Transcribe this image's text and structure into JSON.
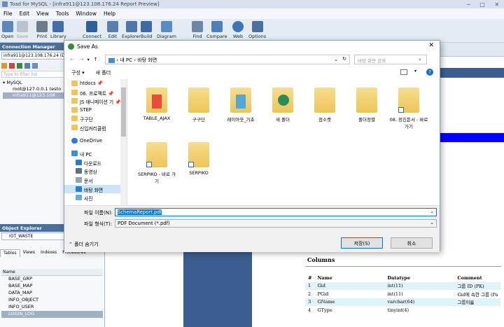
{
  "app": {
    "title": "Toad for MySQL - [infra911@123.108.176.24 Report Preview]"
  },
  "menu": [
    "File",
    "Edit",
    "View",
    "Tools",
    "Window",
    "Help"
  ],
  "toolbar": [
    {
      "label": "Open",
      "icon": "open-icon"
    },
    {
      "label": "Save",
      "icon": "save-icon"
    },
    {
      "label": "Print",
      "icon": "print-icon"
    },
    {
      "label": "Library",
      "icon": "library-icon"
    },
    {
      "label": "Connect",
      "icon": "connect-icon"
    },
    {
      "label": "Edit",
      "icon": "edit-icon"
    },
    {
      "label": "Explorer",
      "icon": "explorer-icon"
    },
    {
      "label": "Build",
      "icon": "build-icon"
    },
    {
      "label": "Diagram",
      "icon": "diagram-icon"
    },
    {
      "label": "Find",
      "icon": "find-icon"
    },
    {
      "label": "Compare",
      "icon": "compare-icon"
    },
    {
      "label": "Web",
      "icon": "web-icon"
    },
    {
      "label": "Options",
      "icon": "options-icon"
    }
  ],
  "connection_manager": {
    "title": "Connection Manager",
    "selected": "infra911@123.108.176.24 (DT)",
    "filter_placeholder": "Type to filter list",
    "tree": [
      "MySQL",
      "root@127.0.0.1 (esto",
      "infra911@123.108"
    ]
  },
  "object_explorer": {
    "title": "Object Explorer",
    "db": "IOT_WASTE",
    "tabs": [
      "Tables",
      "Views",
      "Indexes",
      "Procedures"
    ],
    "column_header": "Name",
    "tables": [
      "BASE_GRP",
      "BASE_MAP",
      "DATA_MAP",
      "INFO_OBJECT",
      "INFO_USER",
      "LOGIN_LOG"
    ]
  },
  "report": {
    "heading": "Columns",
    "columns": [
      "#",
      "Name",
      "Datatype",
      "Comment"
    ],
    "rows": [
      [
        "1",
        "Gid",
        "int(11)",
        "그룹 ID (PK)"
      ],
      [
        "2",
        "PGid",
        "int(11)",
        "Gid에 속한 그룹 (Pa"
      ],
      [
        "3",
        "GName",
        "varchar(64)",
        "그룹이름"
      ],
      [
        "4",
        "GType",
        "tinyint(4)",
        ""
      ]
    ]
  },
  "dialog": {
    "title": "Save As",
    "path": [
      "내 PC",
      "바탕 화면"
    ],
    "search_placeholder": "바탕 화면 검색",
    "organize": "구성 ▾",
    "new_folder": "새 폴더",
    "nav": [
      {
        "label": "htdocs",
        "pin": "📌"
      },
      {
        "label": "06. 프로젝트",
        "pin": "📌"
      },
      {
        "label": "JS 애니메이션 기",
        "pin": "📌"
      },
      {
        "label": "STEP",
        "pin": ""
      },
      {
        "label": "구구단",
        "pin": ""
      },
      {
        "label": "신입커리큘럼",
        "pin": ""
      },
      {
        "label": "OneDrive",
        "pin": ""
      },
      {
        "label": "내 PC",
        "pin": ""
      },
      {
        "label": "다운로드",
        "pin": ""
      },
      {
        "label": "동영상",
        "pin": ""
      },
      {
        "label": "문서",
        "pin": ""
      },
      {
        "label": "바탕 화면",
        "pin": ""
      },
      {
        "label": "사진",
        "pin": ""
      }
    ],
    "files": [
      {
        "label": "TABLE_AJAX",
        "kind": "docs-folder"
      },
      {
        "label": "구구단",
        "kind": "folder"
      },
      {
        "label": "레이아웃_기초",
        "kind": "docs-folder"
      },
      {
        "label": "새 폴더",
        "kind": "chrome-folder"
      },
      {
        "label": "점소켓",
        "kind": "folder"
      },
      {
        "label": "폴더정렬",
        "kind": "folder"
      },
      {
        "label": "08. 정진돈서 - 바로 가기",
        "kind": "shortcut"
      },
      {
        "label": "SERPIKO - 바로 가기",
        "kind": "shortcut"
      },
      {
        "label": "SERPIKO",
        "kind": "shortcut"
      }
    ],
    "filename_label": "파일 이름(N):",
    "filename_value": "SchemaReport.pdf",
    "filetype_label": "파일 형식(T):",
    "filetype_value": "PDF Document (*.pdf)",
    "hide_folders": "폴더 숨기기",
    "save": "저장(S)",
    "cancel": "취소"
  },
  "colors": {
    "accent": "#0078d7",
    "panel_header": "#4a6f9b",
    "report_band": "#0000ff"
  }
}
